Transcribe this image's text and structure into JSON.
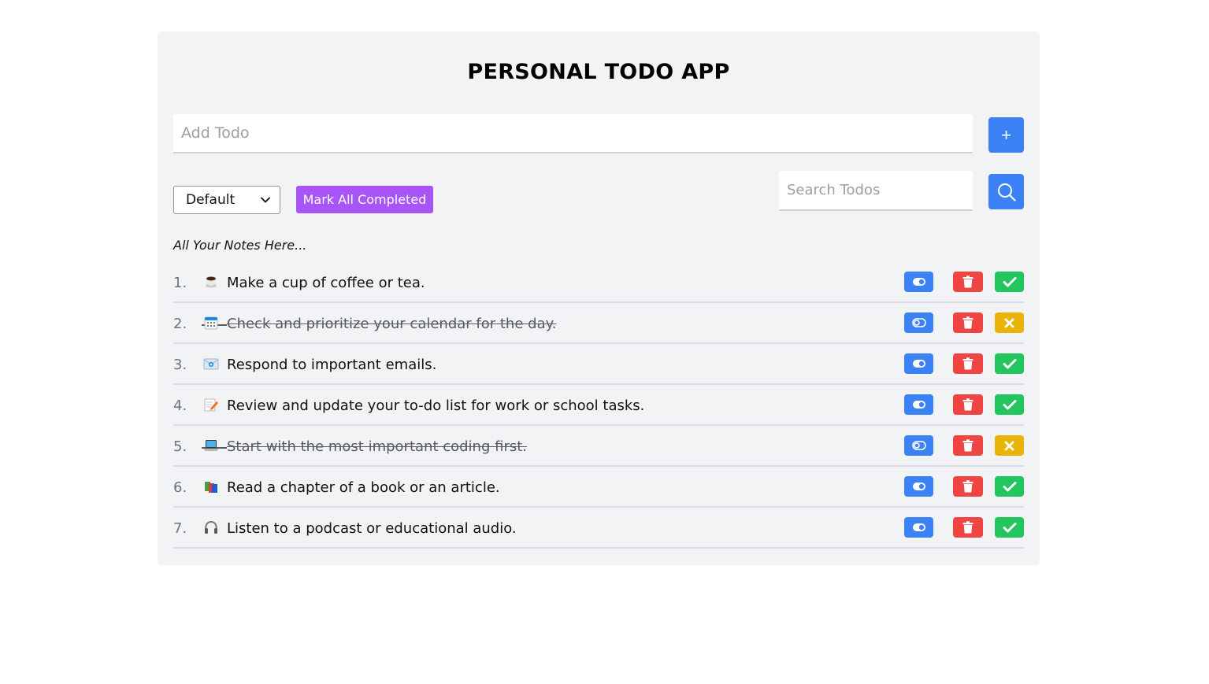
{
  "app": {
    "title": "PERSONAL TODO APP"
  },
  "add_todo": {
    "placeholder": "Add Todo",
    "button_label": "+"
  },
  "filter": {
    "selected": "Default"
  },
  "mark_all": {
    "label": "Mark All Completed"
  },
  "search": {
    "placeholder": "Search Todos"
  },
  "notes_heading": "All Your Notes Here...",
  "todos": [
    {
      "number": "1.",
      "emoji": "coffee-cup-icon",
      "text": "Make a cup of coffee or tea.",
      "completed": false
    },
    {
      "number": "2.",
      "emoji": "calendar-icon",
      "text": "Check and prioritize your calendar for the day.",
      "completed": true
    },
    {
      "number": "3.",
      "emoji": "email-icon",
      "text": "Respond to important emails.",
      "completed": false
    },
    {
      "number": "4.",
      "emoji": "memo-pencil-icon",
      "text": "Review and update your to-do list for work or school tasks.",
      "completed": false
    },
    {
      "number": "5.",
      "emoji": "laptop-icon",
      "text": "Start with the most important coding first.",
      "completed": true
    },
    {
      "number": "6.",
      "emoji": "books-icon",
      "text": "Read a chapter of a book or an article.",
      "completed": false
    },
    {
      "number": "7.",
      "emoji": "headphones-icon",
      "text": "Listen to a podcast or educational audio.",
      "completed": false
    }
  ],
  "colors": {
    "primary": "#3b82f6",
    "accent_purple": "#a855f7",
    "danger": "#ef4444",
    "success": "#22c55e",
    "warning": "#eab308",
    "card_bg": "#f2f3f5"
  }
}
